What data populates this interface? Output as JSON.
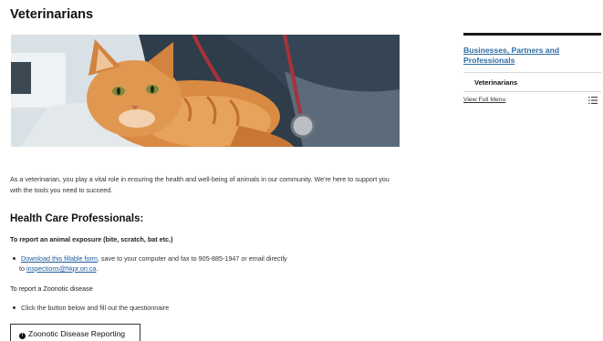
{
  "page": {
    "title": "Veterinarians",
    "intro": "As a veterinarian, you play a vital role in ensuring the health and well-being of animals in our community. We're here to support you with the tools you need to succeed."
  },
  "content": {
    "heading": "Health Care Professionals:",
    "exposure": {
      "label": "To report an animal exposure (bite, scratch, bat etc.)",
      "link_text": "Download this fillable form",
      "text_after_link": ", save to your computer and fax to 905-885-1947 or email directly",
      "to_prefix": "to ",
      "email": "inspections@hkpr.on.ca",
      "period": "."
    },
    "zoonotic": {
      "label": "To report a Zoonotic disease",
      "bullet": "Click the button below and fill out the questionnaire",
      "button_label": "Zoonotic Disease Reporting",
      "button_icon": "!"
    }
  },
  "sidebar": {
    "section_link": "Businesses, Partners and Professionals",
    "current_item": "Veterinarians",
    "view_full_menu": "View Full Menu"
  }
}
